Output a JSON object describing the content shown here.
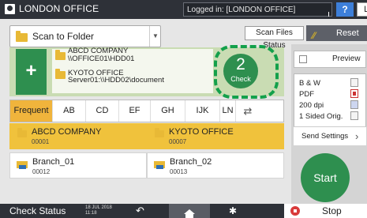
{
  "topbar": {
    "title": "LONDON OFFICE",
    "login_status": "Logged in: [LONDON OFFICE]",
    "help_label": "?",
    "logout_label": "Logout"
  },
  "destination_type": {
    "label": "Scan to Folder"
  },
  "header_buttons": {
    "scan_files_status": "Scan Files Status",
    "reset": "Reset"
  },
  "selected_destinations": {
    "add_label": "+",
    "rows": [
      "ABCD COMPANY",
      "\\\\OFFICE01\\HDD01",
      "KYOTO OFFICE",
      "Server01:\\\\HDD02\\document"
    ],
    "check_count": "2",
    "check_label": "Check"
  },
  "tabs": [
    {
      "label": "Frequent",
      "active": true
    },
    {
      "label": "AB"
    },
    {
      "label": "CD"
    },
    {
      "label": "EF"
    },
    {
      "label": "GH"
    },
    {
      "label": "IJK"
    },
    {
      "label": "LN"
    }
  ],
  "address_book": [
    {
      "name": "ABCD COMPANY",
      "number": "00001",
      "selected": true,
      "type": "folder"
    },
    {
      "name": "KYOTO OFFICE",
      "number": "00007",
      "selected": true,
      "type": "folder"
    },
    {
      "name": "Branch_01",
      "number": "00012",
      "selected": false,
      "type": "network"
    },
    {
      "name": "Branch_02",
      "number": "00013",
      "selected": false,
      "type": "network"
    }
  ],
  "scan_settings": {
    "preview_label": "Preview",
    "color_mode": "B & W",
    "file_type": "PDF",
    "resolution": "200 dpi",
    "original": "1 Sided Orig.",
    "send_settings": "Send Settings",
    "start_label": "Start"
  },
  "bottombar": {
    "check_status": "Check Status",
    "date": "18 JUL 2018",
    "time": "11:18",
    "stop_label": "Stop"
  },
  "colors": {
    "accent_green": "#2e8f4f",
    "tab_active": "#f0b43c",
    "highlight_dash": "#13a04b"
  }
}
